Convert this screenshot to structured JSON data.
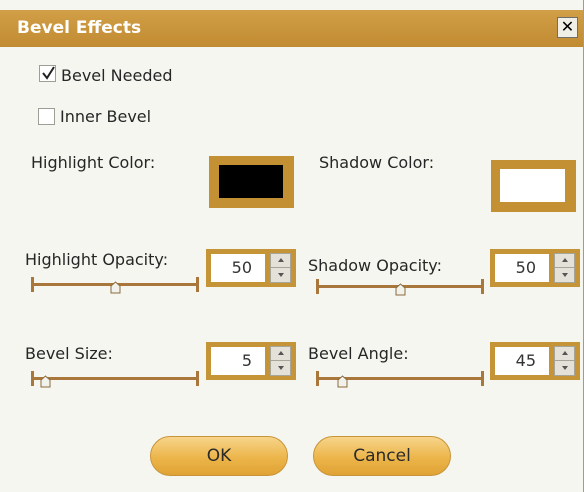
{
  "dialog": {
    "title": "Bevel Effects",
    "close_glyph": "✕"
  },
  "options": {
    "bevel_needed": {
      "label": "Bevel Needed",
      "checked": true
    },
    "inner_bevel": {
      "label": "Inner Bevel",
      "checked": false
    }
  },
  "colors": {
    "highlight_label": "Highlight Color:",
    "highlight_value": "#000000",
    "shadow_label": "Shadow Color:",
    "shadow_value": "#ffffff",
    "frame": "#c39033"
  },
  "controls": {
    "highlight_opacity": {
      "label": "Highlight Opacity:",
      "value": "50",
      "slider_fraction": 0.5
    },
    "shadow_opacity": {
      "label": "Shadow Opacity:",
      "value": "50",
      "slider_fraction": 0.5
    },
    "bevel_size": {
      "label": "Bevel Size:",
      "value": "5",
      "slider_fraction": 0.05
    },
    "bevel_angle": {
      "label": "Bevel Angle:",
      "value": "45",
      "slider_fraction": 0.125
    }
  },
  "buttons": {
    "ok": "OK",
    "cancel": "Cancel"
  },
  "icons": {
    "close": "close-icon",
    "check": "checkmark-icon",
    "spin_up": "chevron-up-icon",
    "spin_down": "chevron-down-icon"
  }
}
